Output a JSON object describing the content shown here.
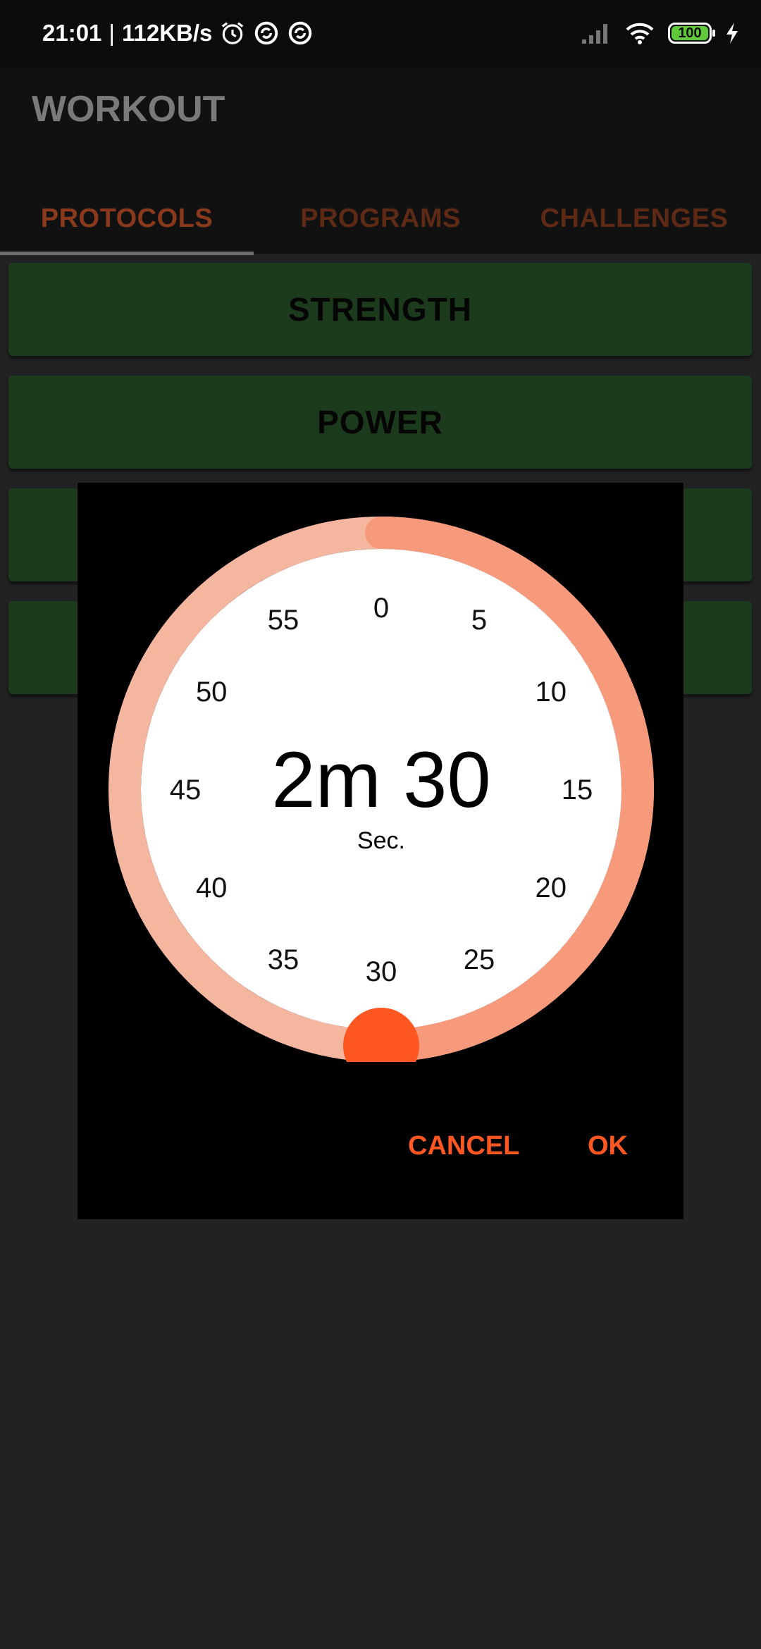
{
  "status_bar": {
    "time": "21:01",
    "separator": "|",
    "network_speed": "112KB/s",
    "left_icons": [
      "alarm-icon",
      "sync-icon",
      "sync-icon"
    ],
    "right_icons": [
      "signal-icon",
      "wifi-icon",
      "battery-icon",
      "charging-icon"
    ],
    "battery_level": "100"
  },
  "app_bar": {
    "title": "WORKOUT",
    "tabs": [
      {
        "label": "PROTOCOLS",
        "active": true
      },
      {
        "label": "PROGRAMS",
        "active": false
      },
      {
        "label": "CHALLENGES",
        "active": false
      }
    ]
  },
  "protocols": {
    "items": [
      {
        "label": "STRENGTH"
      },
      {
        "label": "POWER"
      },
      {
        "label": ""
      },
      {
        "label": ""
      }
    ]
  },
  "timer_dialog": {
    "minutes_value": "2m",
    "seconds_value": "30",
    "unit_label": "Sec.",
    "selected_seconds": 30,
    "dial_numbers": [
      "0",
      "5",
      "10",
      "15",
      "20",
      "25",
      "30",
      "35",
      "40",
      "45",
      "50",
      "55"
    ],
    "cancel_label": "CANCEL",
    "ok_label": "OK",
    "colors": {
      "ring_track": "#f5b6a0",
      "ring_progress": "#f79a7c",
      "knob": "#ff5722",
      "face": "#ffffff",
      "accent": "#ff5722"
    }
  }
}
